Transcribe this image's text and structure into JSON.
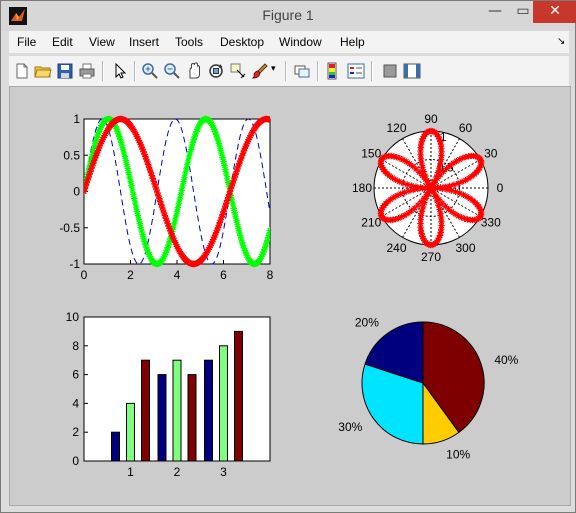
{
  "window": {
    "title": "Figure 1",
    "minimize_glyph": "—",
    "maximize_glyph": "▭",
    "close_glyph": "✕"
  },
  "menu": [
    "File",
    "Edit",
    "View",
    "Insert",
    "Tools",
    "Desktop",
    "Window",
    "Help"
  ],
  "toolbar_icons": [
    "new-figure-icon",
    "open-file-icon",
    "save-icon",
    "print-icon",
    "pointer-icon",
    "zoom-in-icon",
    "zoom-out-icon",
    "pan-icon",
    "rotate-3d-icon",
    "data-cursor-icon",
    "brush-icon",
    "link-icon",
    "colorbar-icon",
    "legend-icon",
    "hide-plot-tools-icon",
    "show-plot-tools-icon"
  ],
  "colors": {
    "green": "#00ff00",
    "red": "#ff0000",
    "blue": "#0000cc",
    "navy": "#00007f",
    "light_green": "#7fff7f",
    "maroon": "#7f0000",
    "cyan": "#00e5ff",
    "gold": "#ffcc00"
  },
  "chart_data": [
    {
      "type": "line",
      "xlim": [
        0,
        8
      ],
      "ylim": [
        -1,
        1
      ],
      "xticks": [
        "0",
        "2",
        "4",
        "6",
        "8"
      ],
      "yticks": [
        "-1",
        "-0.5",
        "0",
        "0.5",
        "1"
      ],
      "series": [
        {
          "function": "sin(2x)",
          "style": "dashed",
          "color": "blue"
        },
        {
          "function": "sin(1.5x)",
          "style": "star markers",
          "color": "green"
        },
        {
          "function": "sin(x)",
          "style": "star markers",
          "color": "red"
        }
      ]
    },
    {
      "type": "polar",
      "function": "r = |sin(3θ)|",
      "color": "red",
      "radial_ticks": [
        "0.5",
        "1"
      ],
      "angle_labels": [
        "0",
        "30",
        "60",
        "90",
        "120",
        "150",
        "180",
        "210",
        "240",
        "270",
        "300",
        "330"
      ]
    },
    {
      "type": "bar",
      "categories": [
        "1",
        "2",
        "3"
      ],
      "ylim": [
        0,
        10
      ],
      "yticks": [
        "0",
        "2",
        "4",
        "6",
        "8",
        "10"
      ],
      "series": [
        {
          "color": "navy",
          "values": [
            2,
            6,
            7
          ]
        },
        {
          "color": "light_green",
          "values": [
            4,
            7,
            8
          ]
        },
        {
          "color": "maroon",
          "values": [
            7,
            6,
            9
          ]
        }
      ]
    },
    {
      "type": "pie",
      "slices": [
        {
          "value": 40,
          "label": "40%",
          "color": "maroon"
        },
        {
          "value": 10,
          "label": "10%",
          "color": "gold"
        },
        {
          "value": 30,
          "label": "30%",
          "color": "cyan"
        },
        {
          "value": 20,
          "label": "20%",
          "color": "navy"
        }
      ]
    }
  ]
}
